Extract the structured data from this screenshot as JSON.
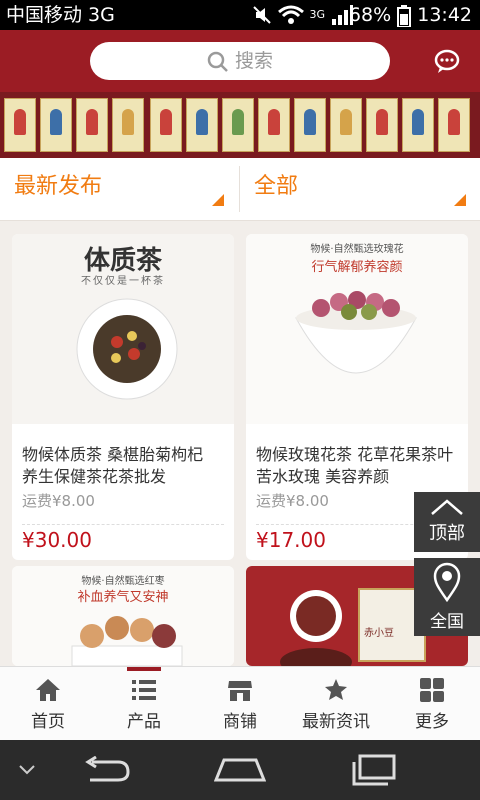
{
  "status": {
    "carrier": "中国移动 3G",
    "battery": "68%",
    "time": "13:42",
    "net": "3G"
  },
  "header": {
    "search_placeholder": "搜索"
  },
  "filters": {
    "left": "最新发布",
    "right": "全部"
  },
  "products": [
    {
      "title": "物候体质茶 桑椹胎菊枸杞 养生保健茶花茶批发",
      "shipping": "运费¥8.00",
      "price": "¥30.00",
      "image_text": "体质茶",
      "image_sub": "不仅仅是一杯茶"
    },
    {
      "title": "物候玫瑰花茶 花草花果茶叶苦水玫瑰 美容养颜",
      "shipping": "运费¥8.00",
      "price": "¥17.00",
      "image_text": "物候·自然甄选玫瑰花",
      "image_sub": "行气解郁养容颜"
    },
    {
      "title": "",
      "shipping": "",
      "price": "",
      "image_text": "物候·自然甄选红枣",
      "image_sub": "补血养气又安神"
    },
    {
      "title": "",
      "shipping": "",
      "price": "",
      "image_text": "赤小豆",
      "image_sub": ""
    }
  ],
  "floating": {
    "top": "顶部",
    "national": "全国"
  },
  "tabs": [
    {
      "label": "首页",
      "icon": "home-icon"
    },
    {
      "label": "产品",
      "icon": "list-icon"
    },
    {
      "label": "商铺",
      "icon": "store-icon"
    },
    {
      "label": "最新资讯",
      "icon": "news-icon"
    },
    {
      "label": "更多",
      "icon": "grid-icon"
    }
  ],
  "colors": {
    "brand": "#9b1c24",
    "accent": "#f17c12",
    "price": "#c0111b"
  }
}
